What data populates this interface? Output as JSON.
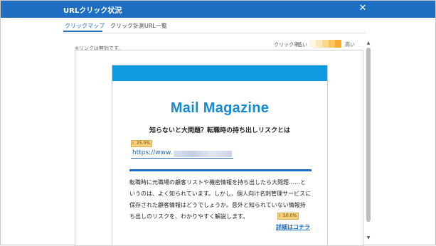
{
  "window": {
    "title": "URLクリック状況",
    "close_glyph": "✕"
  },
  "tabs": [
    {
      "label": "クリックマップ",
      "active": true
    },
    {
      "label": "クリック計測URL一覧",
      "active": false
    }
  ],
  "note": "※リンクは無効です。",
  "legend": {
    "label": "クリック率：",
    "low": "低い",
    "high": "高い",
    "colors": [
      "#fff7e6",
      "#ffe9b8",
      "#ffd98a",
      "#ffc55c",
      "#f7aa33"
    ]
  },
  "preview": {
    "header_color": "#0e9be0",
    "title": "Mail Magazine",
    "subtitle": "知らないと大問題？転職時の持ち出しリスクとは",
    "link_badge": "25.0%",
    "link_url": "https://www.",
    "body_lines": [
      "転職時に元職場の顧客リストや機密情報を持ち出したら大問題……と",
      "いうのは、よく知られています。しかし、個人向け名刺管理サービスに",
      "保存された顧客情報はどうでしょうか。意外と知られていない情報持",
      "ち出しのリスクを、わかりやすく解説します。"
    ],
    "detail_badge": "50.0%",
    "detail_link": "詳細はコチラ"
  }
}
